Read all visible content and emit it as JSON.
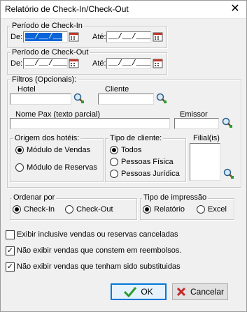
{
  "window": {
    "title": "Relatório de Check-In/Check-Out",
    "close_glyph": "✕"
  },
  "periodo_checkin": {
    "legend": "Período de Check-In",
    "de_label": "De:",
    "de_value": "__/__/__",
    "ate_label": "Até:",
    "ate_value": "__/__/____"
  },
  "periodo_checkout": {
    "legend": "Período de Check-Out",
    "de_label": "De:",
    "de_value": "__/__/____",
    "ate_label": "Até:",
    "ate_value": "__/__/____"
  },
  "filtros": {
    "legend": "Filtros (Opcionais):",
    "hotel_label": "Hotel",
    "hotel_value": "",
    "cliente_label": "Cliente",
    "cliente_value": "",
    "nomepax_label": "Nome Pax (texto parcial)",
    "nomepax_value": "",
    "emissor_label": "Emissor",
    "emissor_value": "",
    "origem": {
      "legend": "Origem dos hotéis:",
      "options": [
        "Módulo de Vendas",
        "Módulo de Reservas"
      ],
      "selected": 0
    },
    "tipo_cliente": {
      "legend": "Tipo de cliente:",
      "options": [
        "Todos",
        "Pessoas Física",
        "Pessoas Jurídica"
      ],
      "selected": 0
    },
    "filial_label": "Filial(is)"
  },
  "ordenar": {
    "legend": "Ordenar por",
    "options": [
      "Check-In",
      "Check-Out"
    ],
    "selected": 0
  },
  "tipo_impressao": {
    "legend": "Tipo de impressão",
    "options": [
      "Relatório",
      "Excel"
    ],
    "selected": 0
  },
  "checkboxes": [
    {
      "label": "Exibir inclusive vendas ou reservas canceladas",
      "checked": false
    },
    {
      "label": "Não exibir vendas que constem em reembolsos.",
      "checked": true
    },
    {
      "label": "Não exibir vendas que tenham sido substituidas",
      "checked": true
    }
  ],
  "buttons": {
    "ok": "OK",
    "cancelar": "Cancelar"
  },
  "colors": {
    "accent": "#0078d7",
    "ok_check": "#2a9d2a",
    "cancel_x": "#c62828"
  }
}
